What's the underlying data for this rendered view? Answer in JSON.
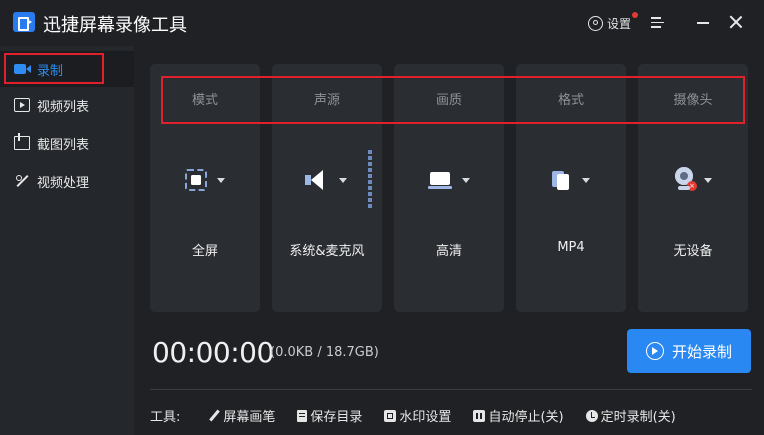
{
  "app": {
    "title": "迅捷屏幕录像工具"
  },
  "titlebar": {
    "settings_label": "设置"
  },
  "sidebar": {
    "items": [
      {
        "label": "录制",
        "icon": "record-icon",
        "active": true
      },
      {
        "label": "视频列表",
        "icon": "video-list-icon",
        "active": false
      },
      {
        "label": "截图列表",
        "icon": "screenshot-list-icon",
        "active": false
      },
      {
        "label": "视频处理",
        "icon": "video-process-icon",
        "active": false
      }
    ]
  },
  "options": [
    {
      "header": "模式",
      "value": "全屏",
      "icon": "fullscreen-icon"
    },
    {
      "header": "声源",
      "value": "系统&麦克风",
      "icon": "speaker-icon"
    },
    {
      "header": "画质",
      "value": "高清",
      "icon": "screen-icon"
    },
    {
      "header": "格式",
      "value": "MP4",
      "icon": "file-icon"
    },
    {
      "header": "摄像头",
      "value": "无设备",
      "icon": "camera-icon"
    }
  ],
  "recording": {
    "timer": "00:00:00",
    "storage": "(0.0KB / 18.7GB)",
    "start_label": "开始录制"
  },
  "tools": {
    "label": "工具:",
    "items": [
      {
        "label": "屏幕画笔",
        "icon": "pen-icon"
      },
      {
        "label": "保存目录",
        "icon": "folder-doc-icon"
      },
      {
        "label": "水印设置",
        "icon": "watermark-icon"
      },
      {
        "label": "自动停止(关)",
        "icon": "pause-icon"
      },
      {
        "label": "定时录制(关)",
        "icon": "clock-icon"
      }
    ]
  },
  "colors": {
    "accent": "#2a88f2",
    "highlight": "#e0202a",
    "background": "#1f2125"
  }
}
